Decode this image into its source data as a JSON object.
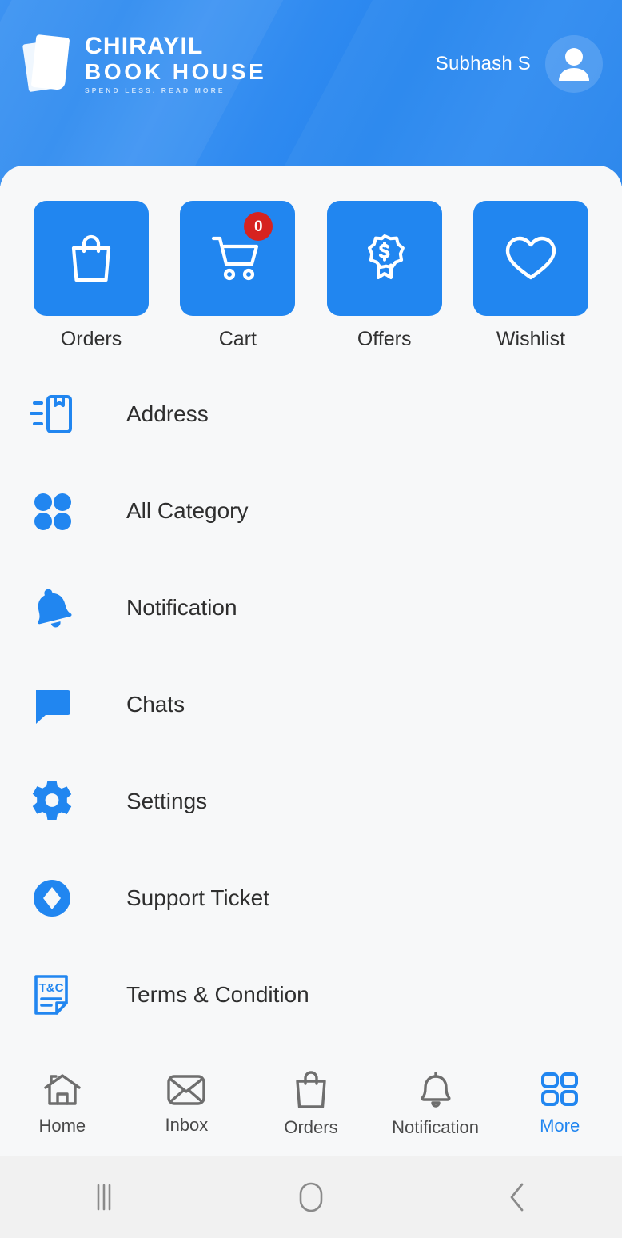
{
  "header": {
    "brand_line1": "CHIRAYIL",
    "brand_line2": "BOOK HOUSE",
    "brand_tagline": "SPEND LESS. READ MORE",
    "user_name": "Subhash S",
    "brand_color": "#2186f0",
    "header_gradient_from": "#3d93f2",
    "header_gradient_to": "#2583ec"
  },
  "quick_tiles": [
    {
      "label": "Orders",
      "icon": "shopping-bag-icon",
      "badge": null
    },
    {
      "label": "Cart",
      "icon": "shopping-cart-icon",
      "badge": "0"
    },
    {
      "label": "Offers",
      "icon": "offer-badge-icon",
      "badge": null
    },
    {
      "label": "Wishlist",
      "icon": "heart-icon",
      "badge": null
    }
  ],
  "menu": {
    "items": [
      {
        "label": "Address",
        "icon": "package-box-icon"
      },
      {
        "label": "All Category",
        "icon": "four-dots-icon"
      },
      {
        "label": "Notification",
        "icon": "bell-filled-icon"
      },
      {
        "label": "Chats",
        "icon": "chat-bubble-icon"
      },
      {
        "label": "Settings",
        "icon": "gear-icon"
      },
      {
        "label": "Support Ticket",
        "icon": "support-diamond-icon"
      },
      {
        "label": "Terms & Condition",
        "icon": "terms-document-icon"
      }
    ]
  },
  "bottom_nav": {
    "active": "More",
    "active_color": "#2186f0",
    "inactive_color": "#6e6e6e",
    "items": [
      {
        "label": "Home",
        "icon": "home-icon",
        "active": false
      },
      {
        "label": "Inbox",
        "icon": "envelope-icon",
        "active": false
      },
      {
        "label": "Orders",
        "icon": "shopping-bag-icon",
        "active": false
      },
      {
        "label": "Notification",
        "icon": "bell-outline-icon",
        "active": false
      },
      {
        "label": "More",
        "icon": "grid-four-icon",
        "active": true
      }
    ]
  },
  "system_nav": {
    "buttons": [
      {
        "name": "recents-button",
        "icon": "recents-bars-icon"
      },
      {
        "name": "home-button",
        "icon": "home-squircle-icon"
      },
      {
        "name": "back-button",
        "icon": "back-chevron-icon"
      }
    ]
  }
}
